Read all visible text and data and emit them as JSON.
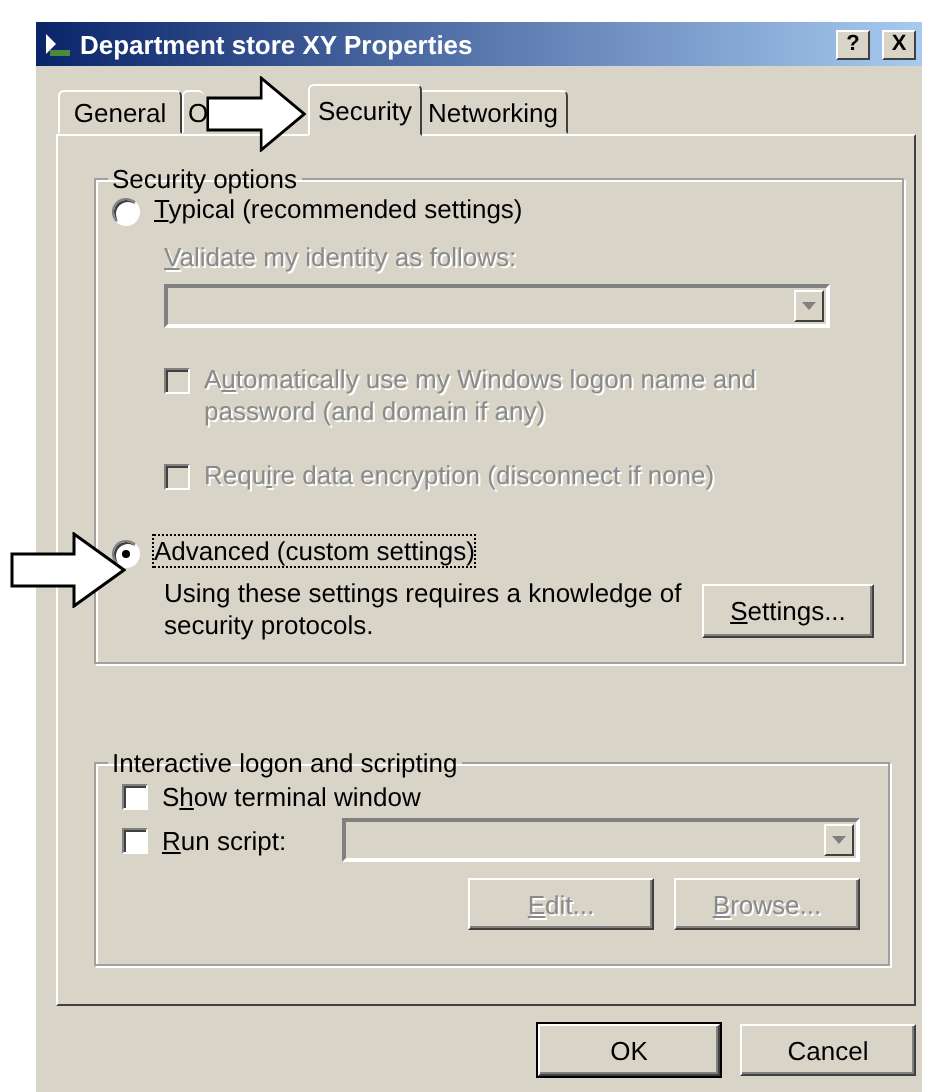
{
  "window": {
    "title": "Department store XY Properties",
    "help_button": "?",
    "close_button": "X"
  },
  "tabs": [
    {
      "label": "General",
      "selected": false
    },
    {
      "label": "O",
      "selected": false
    },
    {
      "label": "Security",
      "selected": true
    },
    {
      "label": "Networking",
      "selected": false
    }
  ],
  "security_options": {
    "legend": "Security options",
    "typical": {
      "label": {
        "key": "T",
        "post": "ypical (recommended settings)"
      },
      "selected": false,
      "disabled": false,
      "focused": false
    },
    "validate_label": {
      "label": {
        "key": "V",
        "post": "alidate my identity as follows:"
      },
      "disabled": true
    },
    "identity_combo": {
      "disabled": true
    },
    "checkboxes": [
      {
        "label": {
          "pre": "A",
          "key": "u",
          "post": "tomatically use my Windows logon name and password (and domain if any)"
        },
        "checked": false,
        "disabled": true
      },
      {
        "label": {
          "pre": "Requ",
          "key": "i",
          "post": "re data encryption (disconnect if none)"
        },
        "checked": false,
        "disabled": true
      }
    ],
    "advanced": {
      "label": {
        "pre": "Advanced (custom settings)"
      },
      "selected": true,
      "disabled": false,
      "focused": true
    },
    "note": "Using these settings requires a knowledge of security protocols.",
    "settings_button": {
      "label": {
        "key": "S",
        "post": "ettings..."
      },
      "disabled": false
    }
  },
  "interactive_logon": {
    "legend": "Interactive logon and scripting",
    "checkboxes": [
      {
        "label": {
          "pre": "S",
          "key": "h",
          "post": "ow terminal window"
        },
        "checked": false,
        "disabled": false
      },
      {
        "label": {
          "key": "R",
          "post": "un script:"
        },
        "checked": false,
        "disabled": false
      }
    ],
    "script_combo": {
      "disabled": true
    },
    "buttons": [
      {
        "label": {
          "key": "E",
          "post": "dit..."
        },
        "disabled": true
      },
      {
        "label": {
          "key": "B",
          "post": "rowse..."
        },
        "disabled": true
      }
    ]
  },
  "buttons": [
    {
      "label": {
        "pre": "OK"
      },
      "disabled": false,
      "default": true
    },
    {
      "label": {
        "pre": "Cancel"
      },
      "disabled": false,
      "default": false
    }
  ]
}
